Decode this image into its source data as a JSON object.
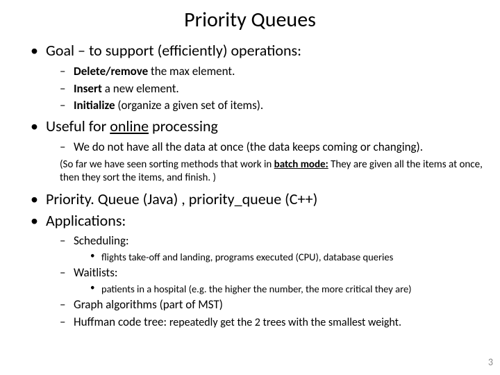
{
  "title": "Priority Queues",
  "b1": {
    "lead": "Goal – to support (efficiently) operations:",
    "ops": {
      "a_b": "Delete/remove",
      "a_r": " the max element.",
      "b_b": "Insert",
      "b_r": " a new element.",
      "c_b": "Initialize",
      "c_r": " (organize a given set of items)."
    }
  },
  "b2": {
    "lead_a": "Useful for ",
    "lead_u": "online",
    "lead_b": " processing",
    "sub": "We do not have all the data at once (the data keeps coming or changing).",
    "paren_a": "(So far we have seen sorting methods that work in ",
    "paren_u": "batch mode:",
    "paren_b": " They are given all the items at once, then they sort the items, and finish. )"
  },
  "b3": "Priority. Queue (Java) , priority_queue (C++)",
  "b4": {
    "lead": "Applications:",
    "sched": "Scheduling:",
    "sched_sub": "flights take-off and landing, programs executed (CPU), database queries",
    "wait": "Waitlists:",
    "wait_sub": "patients in a hospital (e.g. the higher the number, the more critical they are)",
    "graph": "Graph algorithms (part of MST)",
    "huff_a": "Huffman code tree: ",
    "huff_b": "repeatedly get the 2 trees with the smallest weight."
  },
  "page": "3"
}
